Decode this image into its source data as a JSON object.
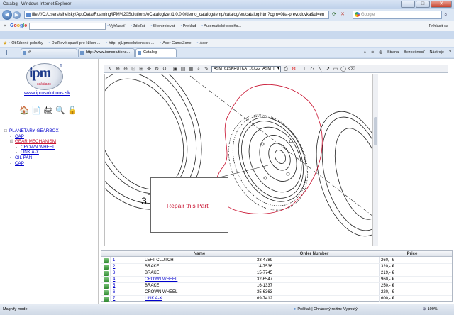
{
  "window": {
    "title": "Catalog - Windows Internet Explorer"
  },
  "address": {
    "url": "file:///C:/Users/sihelsky/AppData/Roaming/IPM%20Solutions/eCatalogizer/1.0.0.0/demo_catalog/temp/catalog/en/catalog.htm?cgm=08a-prevodovka&ui=en",
    "search_placeholder": "Google"
  },
  "google_bar": {
    "logo": "Google",
    "items": [
      "Vyhľadať",
      "Zdieľať",
      "Skontrolovať",
      "Preklad",
      "Automatické doplňa..."
    ],
    "signin": "Prihlásiť sa"
  },
  "favorites": {
    "label": "Obľúbené položky",
    "items": [
      "Diaľkové spustí pre Nikon ...",
      "http--pjUpmsolutions.sk-...",
      "Acer GameZone",
      "Acer"
    ]
  },
  "tabs": [
    {
      "label": "#"
    },
    {
      "label": "http://www.ipmsolutions..."
    },
    {
      "label": "Catalog"
    }
  ],
  "command_bar": [
    "Strana",
    "Bezpečnosť",
    "Nástroje"
  ],
  "sidebar": {
    "logo_text": "ipm",
    "logo_sub": "solutions",
    "logo_reg": "®",
    "site_link": "www.ipmsolutions.sk",
    "tree": [
      {
        "mark": "□",
        "label": "PLANETARY GEARBOX",
        "indent": 0,
        "selected": false
      },
      {
        "mark": "-",
        "label": "CAP",
        "indent": 1,
        "selected": false
      },
      {
        "mark": "⊟",
        "label": "GEAR MECHANISM",
        "indent": 1,
        "selected": true
      },
      {
        "mark": "-",
        "label": "CROWN WHEEL",
        "indent": 2,
        "selected": false
      },
      {
        "mark": "-",
        "label": "LINK A-X",
        "indent": 2,
        "selected": false
      },
      {
        "mark": "-",
        "label": "OIL PAN",
        "indent": 1,
        "selected": false
      },
      {
        "mark": "-",
        "label": "CAP",
        "indent": 1,
        "selected": false
      }
    ]
  },
  "drawing": {
    "part_select": "ASM_61SKRUTKA_16X22_ASM_I",
    "annotation": "Repair this Part",
    "callout": "3"
  },
  "parts_table": {
    "headers": {
      "name": "Name",
      "order": "Order Number",
      "price": "Price"
    },
    "rows": [
      {
        "num": "1",
        "name": "LEFT CLUTCH",
        "link": false,
        "order": "33-4789",
        "price": "260,- €"
      },
      {
        "num": "2",
        "name": "BRAKE",
        "link": false,
        "order": "14-7536",
        "price": "320,- €"
      },
      {
        "num": "3",
        "name": "BRAKE",
        "link": false,
        "order": "15-7745",
        "price": "219,- €"
      },
      {
        "num": "4",
        "name": "CROWN WHEEL",
        "link": true,
        "order": "32-6547",
        "price": "960,- €"
      },
      {
        "num": "5",
        "name": "BRAKE",
        "link": false,
        "order": "16-1337",
        "price": "250,- €"
      },
      {
        "num": "6",
        "name": "CROWN WHEEL",
        "link": false,
        "order": "35-6363",
        "price": "220,- €"
      },
      {
        "num": "7",
        "name": "LINK A-X",
        "link": true,
        "order": "69-7412",
        "price": "600,- €"
      }
    ]
  },
  "status": {
    "left": "Magnify mode.",
    "zone": "Počítač | Chránený režim: Vypnutý",
    "zoom": "100%"
  }
}
